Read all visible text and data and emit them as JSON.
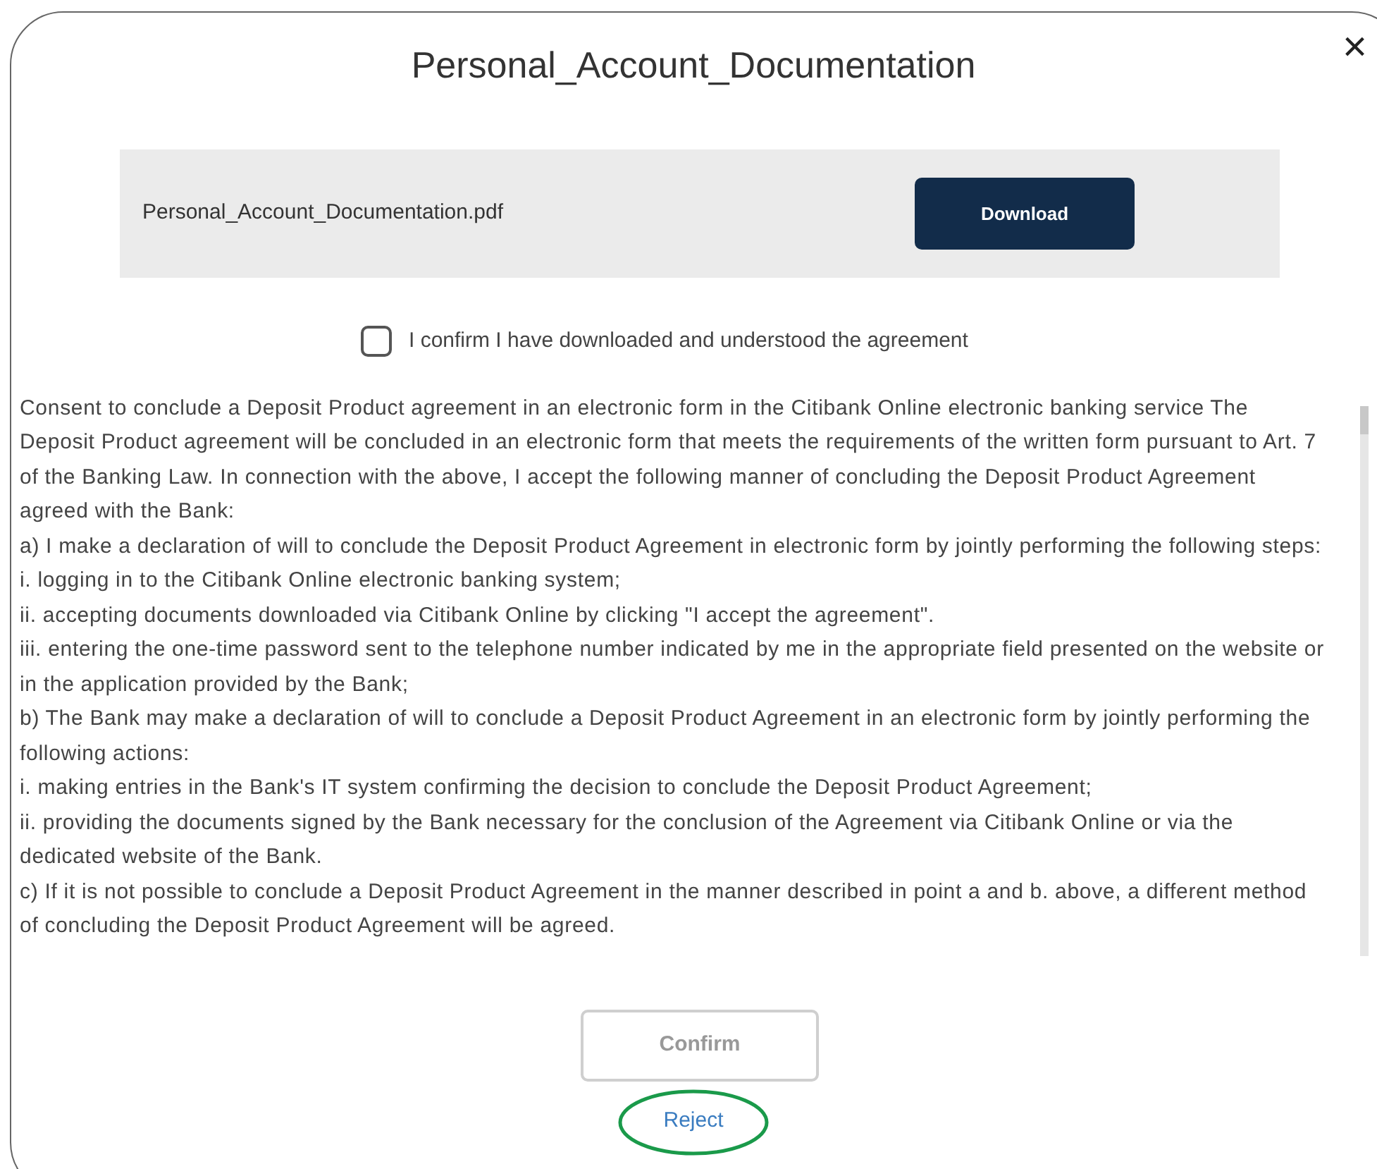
{
  "dialog": {
    "title": "Personal_Account_Documentation",
    "close": "×"
  },
  "file": {
    "name": "Personal_Account_Documentation.pdf",
    "button": "Download"
  },
  "confirmation": {
    "label": "I confirm I have downloaded and understood the agreement",
    "checked": false
  },
  "agreement": [
    "Consent to conclude a Deposit Product agreement in an electronic form in the Citibank Online electronic banking service The Deposit Product agreement will be concluded in an electronic form that meets the requirements of the written form pursuant to Art. 7 of the Banking Law. In connection with the above, I accept the following manner of concluding the Deposit Product Agreement agreed with the Bank:",
    "a)  I make a declaration of will to conclude the Deposit Product Agreement in electronic form by jointly performing the following steps:",
    "i. logging in to the Citibank Online electronic banking system;",
    "ii. accepting documents downloaded via Citibank Online by clicking \"I accept the agreement\".",
    "iii. entering the one-time password sent to the telephone number indicated by me in the appropriate field presented on the website or in the application provided by the Bank;",
    "b)  The Bank may make a declaration of will to conclude a Deposit Product Agreement in an electronic form by jointly performing the following actions:",
    "i. making entries in the Bank's IT system confirming the decision to conclude the Deposit Product Agreement;",
    "ii. providing the documents signed by the Bank necessary for the conclusion of the Agreement via Citibank Online or via the dedicated website of the Bank.",
    "c)  If it is not possible to conclude a Deposit Product Agreement in the manner described in point a and b. above, a different method of concluding the Deposit Product Agreement will be agreed."
  ],
  "confirm_button": {
    "label": "Confirm",
    "disabled": true
  },
  "reject_link": "Reject"
}
